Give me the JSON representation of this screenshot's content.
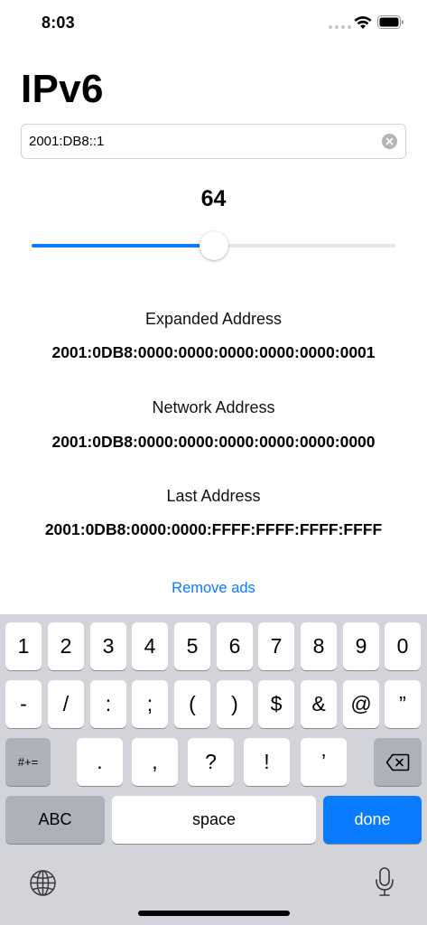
{
  "status_bar": {
    "time": "8:03"
  },
  "title": "IPv6",
  "address_input": {
    "value": "2001:DB8::1"
  },
  "prefix": {
    "value": "64",
    "level_fraction": 0.5
  },
  "results": [
    {
      "label": "Expanded Address",
      "value": "2001:0DB8:0000:0000:0000:0000:0000:0001"
    },
    {
      "label": "Network Address",
      "value": "2001:0DB8:0000:0000:0000:0000:0000:0000"
    },
    {
      "label": "Last Address",
      "value": "2001:0DB8:0000:0000:FFFF:FFFF:FFFF:FFFF"
    }
  ],
  "remove_ads_label": "Remove ads",
  "keyboard": {
    "row1": [
      "1",
      "2",
      "3",
      "4",
      "5",
      "6",
      "7",
      "8",
      "9",
      "0"
    ],
    "row2": [
      "-",
      "/",
      ":",
      ";",
      "(",
      ")",
      "$",
      "&",
      "@",
      "”"
    ],
    "row3": {
      "mode_key": "#+=",
      "keys": [
        ".",
        ",",
        "?",
        "!",
        "’"
      ]
    },
    "row4": {
      "abc_label": "ABC",
      "space_label": "space",
      "done_label": "done"
    }
  },
  "icons": {
    "wifi": "wifi-icon",
    "battery": "battery-icon",
    "clear": "clear-text-icon",
    "delete": "delete-icon",
    "globe": "globe-icon",
    "mic": "microphone-icon"
  },
  "colors": {
    "accent": "#0a7aff",
    "keyboard_bg": "#d2d4d9",
    "key_dark": "#adb1b9"
  }
}
